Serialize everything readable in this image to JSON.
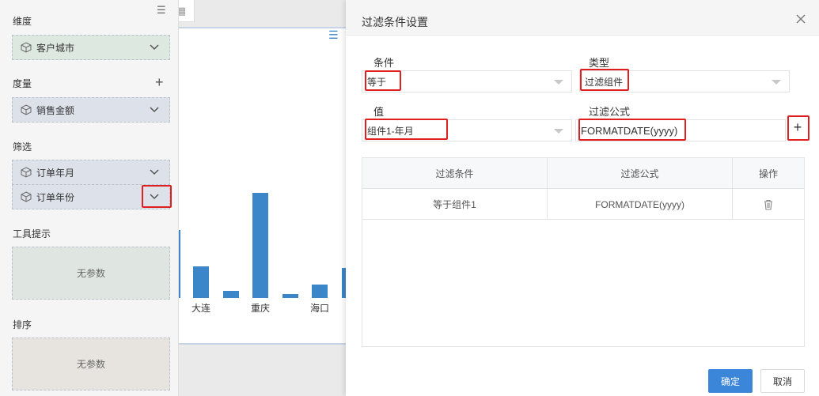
{
  "panel": {
    "dimension_title": "维度",
    "dimension_field": "客户城市",
    "measure_title": "度量",
    "measure_field": "销售金额",
    "filter_title": "筛选",
    "filter_fields": [
      "订单年月",
      "订单年份"
    ],
    "tooltip_title": "工具提示",
    "tooltip_placeholder": "无参数",
    "sort_title": "排序",
    "sort_placeholder": "无参数"
  },
  "chart_data": {
    "type": "bar",
    "categories": [
      "大连",
      "重庆",
      "海口"
    ],
    "series_color": "#3b86c8"
  },
  "dialog": {
    "title": "过滤条件设置",
    "condition_label": "条件",
    "condition_value": "等于",
    "type_label": "类型",
    "type_value": "过滤组件",
    "value_label": "值",
    "value_value": "组件1-年月",
    "formula_label": "过滤公式",
    "formula_value": "FORMATDATE(yyyy)",
    "table": {
      "headers": [
        "过滤条件",
        "过滤公式",
        "操作"
      ],
      "rows": [
        {
          "condition": "等于组件1",
          "formula": "FORMATDATE(yyyy)"
        }
      ]
    },
    "ok_label": "确定",
    "cancel_label": "取消"
  },
  "colors": {
    "primary": "#3b86d8",
    "highlight": "#e02020"
  }
}
